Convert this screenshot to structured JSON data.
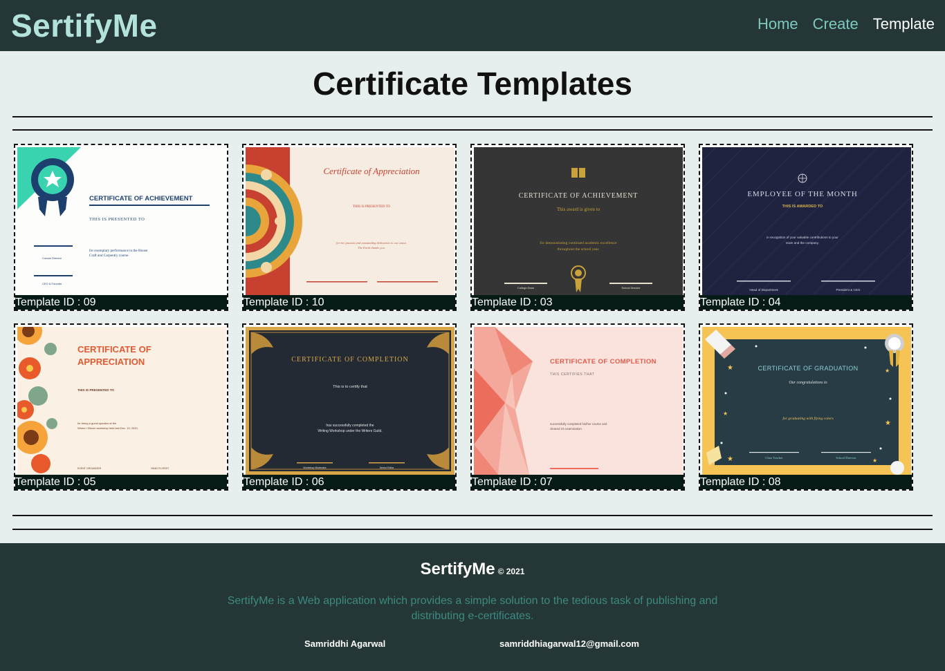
{
  "navbar": {
    "brand": "SertifyMe",
    "links": [
      {
        "label": "Home"
      },
      {
        "label": "Create"
      },
      {
        "label": "Template"
      }
    ]
  },
  "page_title": "Certificate Templates",
  "templates": [
    {
      "caption": "Template ID : 09",
      "title": "CERTIFICATE OF ACHIEVEMENT",
      "subtitle": "THIS IS PRESENTED TO",
      "body": "for exemplary performance in the House Craft and Carpentry course",
      "sig1": "Course Director",
      "sig2": "CEO & Founder"
    },
    {
      "caption": "Template ID : 10",
      "title": "Certificate of Appreciation",
      "subtitle": "THIS IS PRESENTED TO",
      "body": "for her passion and outstanding dedication to our cause. The Earth thanks you."
    },
    {
      "caption": "Template ID : 03",
      "title": "CERTIFICATE OF ACHIEVEMENT",
      "subtitle": "This award is given to",
      "body": "for demonstrating continued academic excellence throughout the school year.",
      "sig1": "College Dean",
      "sig2": "School Director"
    },
    {
      "caption": "Template ID : 04",
      "title": "EMPLOYEE OF THE MONTH",
      "subtitle": "THIS IS AWARDED TO",
      "body": "in recognition of your valuable contributions to your team and the company.",
      "sig1": "Head of Department",
      "sig2": "President & CEO"
    },
    {
      "caption": "Template ID : 05",
      "title_line1": "CERTIFICATE OF",
      "title_line2": "APPRECIATION",
      "subtitle": "THIS IS PRESENTED TO",
      "body": "for being a guest speaker at the Where I Bloom workshop held last Dec. 13, 2020.",
      "sig1": "EVENT ORGANIZER",
      "sig2": "HEAD FLORIST"
    },
    {
      "caption": "Template ID : 06",
      "title": "CERTIFICATE OF COMPLETION",
      "subtitle": "This is to certify that",
      "body": "has successfully completed the Writing Workshop under the Writers Guild.",
      "sig1": "Workshop Moderator",
      "sig2": "Senior Editor"
    },
    {
      "caption": "Template ID : 07",
      "title": "CERTIFICATE OF COMPLETION",
      "subtitle": "THIS CERTIFIES THAT",
      "body": "successfully completed his/her course and cleared it's examination."
    },
    {
      "caption": "Template ID : 08",
      "title": "CERTIFICATE OF GRADUATION",
      "subtitle": "Our congratulations to",
      "body": "for graduating with flying colors",
      "sig1": "Class Teacher",
      "sig2": "School Director"
    }
  ],
  "footer": {
    "brand": "SertifyMe",
    "year": "© 2021",
    "description": "SertifyMe is a Web application which provides a simple solution to the tedious task of publishing and distributing e-certificates.",
    "author": "Samriddhi Agarwal",
    "email": "samriddhiagarwal12@gmail.com"
  },
  "colors": {
    "navbar_bg": "#243635",
    "brand": "#b3e2dd",
    "nav_link": "#7ec9bf",
    "page_bg": "#e6eeee",
    "caption_bg": "#061a16",
    "footer_desc": "#3c8b81"
  }
}
